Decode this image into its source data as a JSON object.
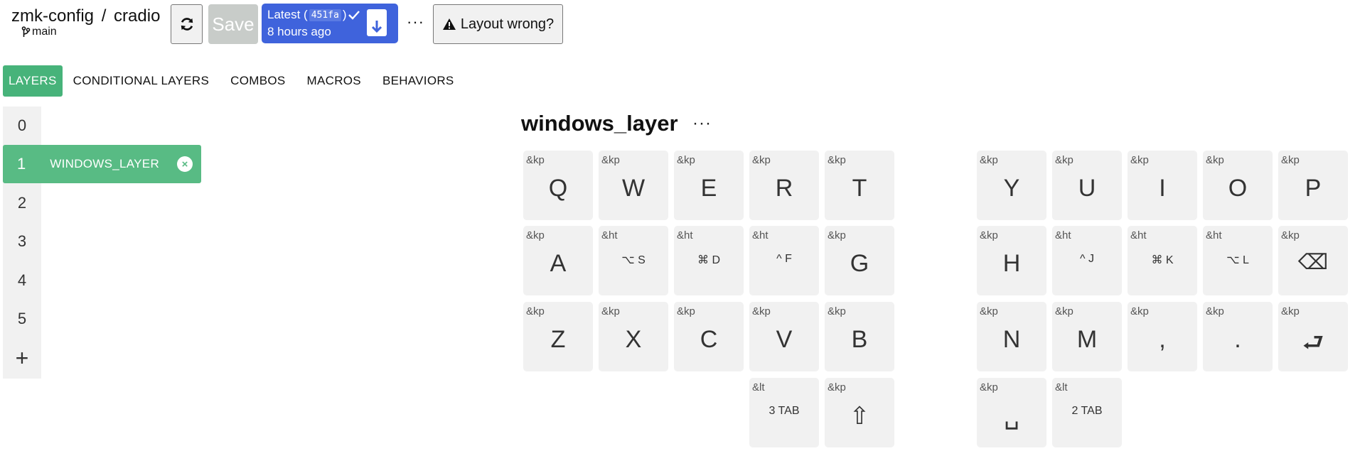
{
  "header": {
    "repo": "zmk-config",
    "separator": "/",
    "keyboard": "cradio",
    "branch": "main",
    "save_label": "Save",
    "latest_label": "Latest (",
    "latest_sha": "451fa",
    "latest_close": ")",
    "latest_time": "8 hours ago",
    "more_label": "···",
    "layout_wrong_label": "Layout wrong?"
  },
  "tabs": [
    "LAYERS",
    "CONDITIONAL LAYERS",
    "COMBOS",
    "MACROS",
    "BEHAVIORS"
  ],
  "layers": {
    "numbers": [
      "0",
      "1",
      "2",
      "3",
      "4",
      "5"
    ],
    "active_index": 1,
    "active_name": "WINDOWS_LAYER",
    "close_label": "×",
    "add_label": "+"
  },
  "keymap": {
    "title": "windows_layer",
    "more_label": "···",
    "keys": [
      {
        "b": "&kp",
        "l": "Q"
      },
      {
        "b": "&kp",
        "l": "W"
      },
      {
        "b": "&kp",
        "l": "E"
      },
      {
        "b": "&kp",
        "l": "R"
      },
      {
        "b": "&kp",
        "l": "T"
      },
      {
        "b": "&kp",
        "l": "Y"
      },
      {
        "b": "&kp",
        "l": "U"
      },
      {
        "b": "&kp",
        "l": "I"
      },
      {
        "b": "&kp",
        "l": "O"
      },
      {
        "b": "&kp",
        "l": "P"
      },
      {
        "b": "&kp",
        "l": "A"
      },
      {
        "b": "&ht",
        "l": "⌥ S"
      },
      {
        "b": "&ht",
        "l": "⌘ D"
      },
      {
        "b": "&ht",
        "l": "^ F"
      },
      {
        "b": "&kp",
        "l": "G"
      },
      {
        "b": "&kp",
        "l": "H"
      },
      {
        "b": "&ht",
        "l": "^ J"
      },
      {
        "b": "&ht",
        "l": "⌘ K"
      },
      {
        "b": "&ht",
        "l": "⌥ L"
      },
      {
        "b": "&kp",
        "l": "⌫"
      },
      {
        "b": "&kp",
        "l": "Z"
      },
      {
        "b": "&kp",
        "l": "X"
      },
      {
        "b": "&kp",
        "l": "C"
      },
      {
        "b": "&kp",
        "l": "V"
      },
      {
        "b": "&kp",
        "l": "B"
      },
      {
        "b": "&kp",
        "l": "N"
      },
      {
        "b": "&kp",
        "l": "M"
      },
      {
        "b": "&kp",
        "l": ","
      },
      {
        "b": "&kp",
        "l": "."
      },
      {
        "b": "&kp",
        "l": "⮐"
      },
      {
        "b": "&lt",
        "l": "3 TAB"
      },
      {
        "b": "&kp",
        "l": "⇧"
      },
      {
        "b": "&kp",
        "l": "␣"
      },
      {
        "b": "&lt",
        "l": "2 TAB"
      }
    ]
  },
  "colors": {
    "accent_green": "#47b37a",
    "active_layer_green": "#58bb84",
    "latest_blue": "#3f63dc",
    "key_bg": "#f1f1f1"
  }
}
